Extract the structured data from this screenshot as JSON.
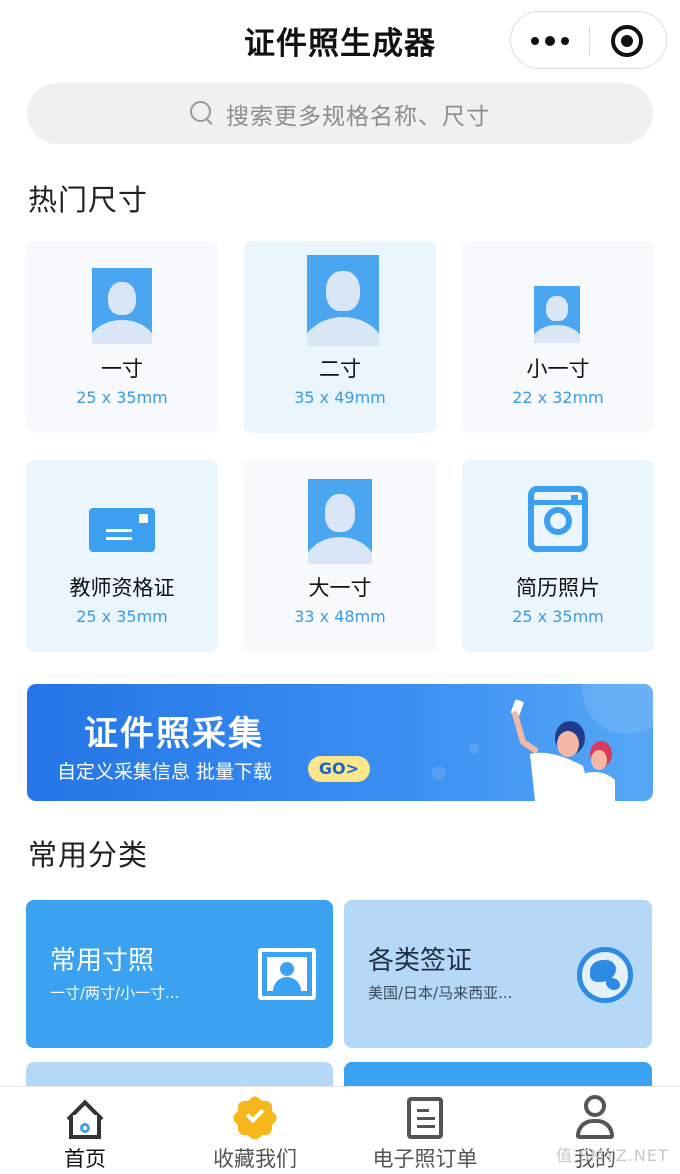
{
  "app": {
    "title": "证件照生成器"
  },
  "search": {
    "placeholder": "搜索更多规格名称、尺寸"
  },
  "hot": {
    "title": "热门尺寸",
    "items": [
      {
        "label": "一寸",
        "size": "25 x 35mm",
        "icon": "portrait-icon"
      },
      {
        "label": "二寸",
        "size": "35 x 49mm",
        "icon": "portrait-icon"
      },
      {
        "label": "小一寸",
        "size": "22 x 32mm",
        "icon": "portrait-icon"
      },
      {
        "label": "教师资格证",
        "size": "25 x 35mm",
        "icon": "card-icon"
      },
      {
        "label": "大一寸",
        "size": "33 x 48mm",
        "icon": "portrait-icon"
      },
      {
        "label": "简历照片",
        "size": "25 x 35mm",
        "icon": "camera-icon"
      }
    ]
  },
  "banner": {
    "title": "证件照采集",
    "subtitle": "自定义采集信息 批量下载",
    "go": "GO>"
  },
  "categories": {
    "title": "常用分类",
    "items": [
      {
        "title": "常用寸照",
        "subtitle": "一寸/两寸/小一寸...",
        "icon": "id-photo-icon"
      },
      {
        "title": "各类签证",
        "subtitle": "美国/日本/马来西亚...",
        "icon": "globe-icon"
      }
    ]
  },
  "tabs": [
    {
      "label": "首页",
      "icon": "home-icon",
      "active": true
    },
    {
      "label": "收藏我们",
      "icon": "badge-icon"
    },
    {
      "label": "电子照订单",
      "icon": "document-icon"
    },
    {
      "label": "我的",
      "icon": "user-icon"
    }
  ],
  "watermark": "值 SMYZ.NET",
  "colors": {
    "accent": "#3ba2f2",
    "card_light": "#b4d8f6",
    "badge": "#f6b71c"
  }
}
